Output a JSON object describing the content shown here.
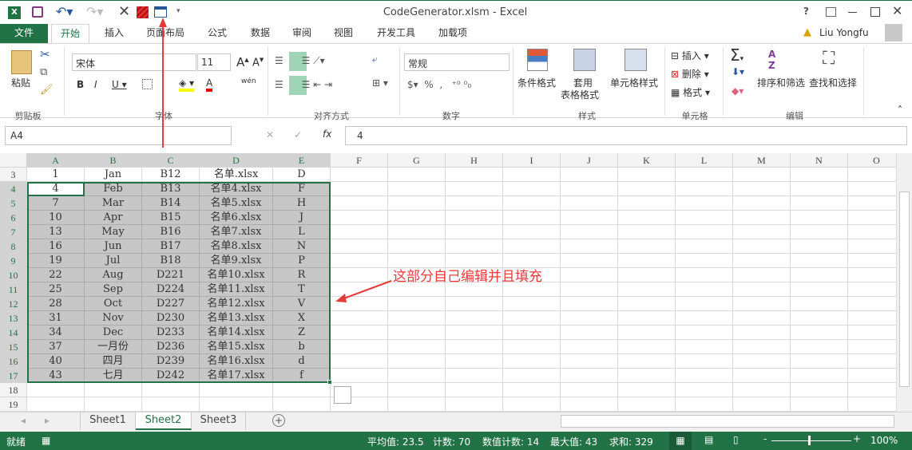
{
  "title": "CodeGenerator.xlsm - Excel",
  "user": "Liu Yongfu",
  "tabs": [
    "文件",
    "开始",
    "插入",
    "页面布局",
    "公式",
    "数据",
    "审阅",
    "视图",
    "开发工具",
    "加载项"
  ],
  "ribbon": {
    "paste": "粘贴",
    "clipboard": "剪贴板",
    "font_name": "宋体",
    "font_size": "11",
    "font": "字体",
    "phonetic": "wén",
    "alignment": "对齐方式",
    "number_format": "常规",
    "number": "数字",
    "cond_format": "条件格式",
    "table_format_1": "套用",
    "table_format_2": "表格格式",
    "cell_styles": "单元格样式",
    "styles": "样式",
    "insert": "插入",
    "delete": "删除",
    "format": "格式",
    "cells": "单元格",
    "sort_filter": "排序和筛选",
    "find_select": "查找和选择",
    "editing": "编辑"
  },
  "formula_bar": {
    "name_box": "A4",
    "fx": "fx",
    "value": "4"
  },
  "columns": [
    "A",
    "B",
    "C",
    "D",
    "E",
    "F",
    "G",
    "H",
    "I",
    "J",
    "K",
    "L",
    "M",
    "N",
    "O"
  ],
  "rows": [
    {
      "n": "3",
      "cells": [
        "1",
        "Jan",
        "B12",
        "名单.xlsx",
        "D"
      ]
    },
    {
      "n": "4",
      "cells": [
        "4",
        "Feb",
        "B13",
        "名单4.xlsx",
        "F"
      ]
    },
    {
      "n": "5",
      "cells": [
        "7",
        "Mar",
        "B14",
        "名单5.xlsx",
        "H"
      ]
    },
    {
      "n": "6",
      "cells": [
        "10",
        "Apr",
        "B15",
        "名单6.xlsx",
        "J"
      ]
    },
    {
      "n": "7",
      "cells": [
        "13",
        "May",
        "B16",
        "名单7.xlsx",
        "L"
      ]
    },
    {
      "n": "8",
      "cells": [
        "16",
        "Jun",
        "B17",
        "名单8.xlsx",
        "N"
      ]
    },
    {
      "n": "9",
      "cells": [
        "19",
        "Jul",
        "B18",
        "名单9.xlsx",
        "P"
      ]
    },
    {
      "n": "10",
      "cells": [
        "22",
        "Aug",
        "D221",
        "名单10.xlsx",
        "R"
      ]
    },
    {
      "n": "11",
      "cells": [
        "25",
        "Sep",
        "D224",
        "名单11.xlsx",
        "T"
      ]
    },
    {
      "n": "12",
      "cells": [
        "28",
        "Oct",
        "D227",
        "名单12.xlsx",
        "V"
      ]
    },
    {
      "n": "13",
      "cells": [
        "31",
        "Nov",
        "D230",
        "名单13.xlsx",
        "X"
      ]
    },
    {
      "n": "14",
      "cells": [
        "34",
        "Dec",
        "D233",
        "名单14.xlsx",
        "Z"
      ]
    },
    {
      "n": "15",
      "cells": [
        "37",
        "一月份",
        "D236",
        "名单15.xlsx",
        "b"
      ]
    },
    {
      "n": "16",
      "cells": [
        "40",
        "四月",
        "D239",
        "名单16.xlsx",
        "d"
      ]
    },
    {
      "n": "17",
      "cells": [
        "43",
        "七月",
        "D242",
        "名单17.xlsx",
        "f"
      ]
    },
    {
      "n": "18",
      "cells": [
        "",
        "",
        "",
        "",
        ""
      ]
    },
    {
      "n": "19",
      "cells": [
        "",
        "",
        "",
        "",
        ""
      ]
    }
  ],
  "annotation": "这部分自己编辑并且填充",
  "sheets": [
    "Sheet1",
    "Sheet2",
    "Sheet3"
  ],
  "active_sheet": "Sheet2",
  "status": {
    "ready": "就绪",
    "average": "平均值: 23.5",
    "count": "计数: 70",
    "numeric_count": "数值计数: 14",
    "max": "最大值: 43",
    "sum": "求和: 329",
    "zoom": "100%"
  },
  "colors": {
    "accent": "#217346",
    "selection": "#c6c6c6",
    "annotation": "#e53b3b"
  }
}
